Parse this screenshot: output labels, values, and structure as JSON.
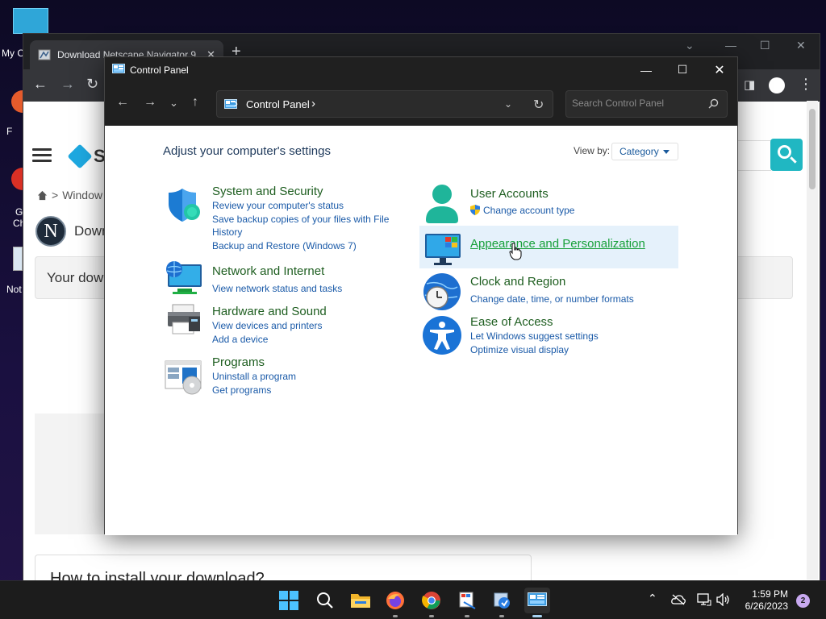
{
  "desktop": {
    "icons": [
      {
        "label": "My C",
        "name": "my-computer"
      },
      {
        "label": "F",
        "name": "firefox"
      },
      {
        "label": "G",
        "name": "google-chrome"
      },
      {
        "label": "Ch",
        "name": "google-chrome-2"
      },
      {
        "label": "Not",
        "name": "notepad"
      }
    ]
  },
  "browser": {
    "tab_title": "Download Netscape Navigator 9",
    "new_tab": "+",
    "site_logo_text": "S",
    "breadcrumb": "Window",
    "download_title": "Downl",
    "notice": "Your dow",
    "howto": "How to install your download?",
    "netscape_letter": "N"
  },
  "control_panel": {
    "window_title": "Control Panel",
    "address": {
      "path": "Control Panel",
      "sep": "›"
    },
    "search_placeholder": "Search Control Panel",
    "heading": "Adjust your computer's settings",
    "view_by_label": "View by:",
    "view_by_value": "Category",
    "categories": [
      {
        "title": "System and Security",
        "links": [
          "Review your computer's status",
          "Save backup copies of your files with File",
          "History",
          "Backup and Restore (Windows 7)"
        ]
      },
      {
        "title": "Network and Internet",
        "links": [
          "View network status and tasks"
        ]
      },
      {
        "title": "Hardware and Sound",
        "links": [
          "View devices and printers",
          "Add a device"
        ]
      },
      {
        "title": "Programs",
        "links": [
          "Uninstall a program",
          "Get programs"
        ]
      },
      {
        "title": "User Accounts",
        "links": [
          "Change account type"
        ]
      },
      {
        "title": "Appearance and Personalization",
        "links": []
      },
      {
        "title": "Clock and Region",
        "links": [
          "Change date, time, or number formats"
        ]
      },
      {
        "title": "Ease of Access",
        "links": [
          "Let Windows suggest settings",
          "Optimize visual display"
        ]
      }
    ]
  },
  "taskbar": {
    "time": "1:59 PM",
    "date": "6/26/2023",
    "notifications": "2"
  },
  "colors": {
    "accent": "#1a5aa8",
    "category_green": "#1e5e20",
    "hover_bg": "#e5f1fb"
  }
}
